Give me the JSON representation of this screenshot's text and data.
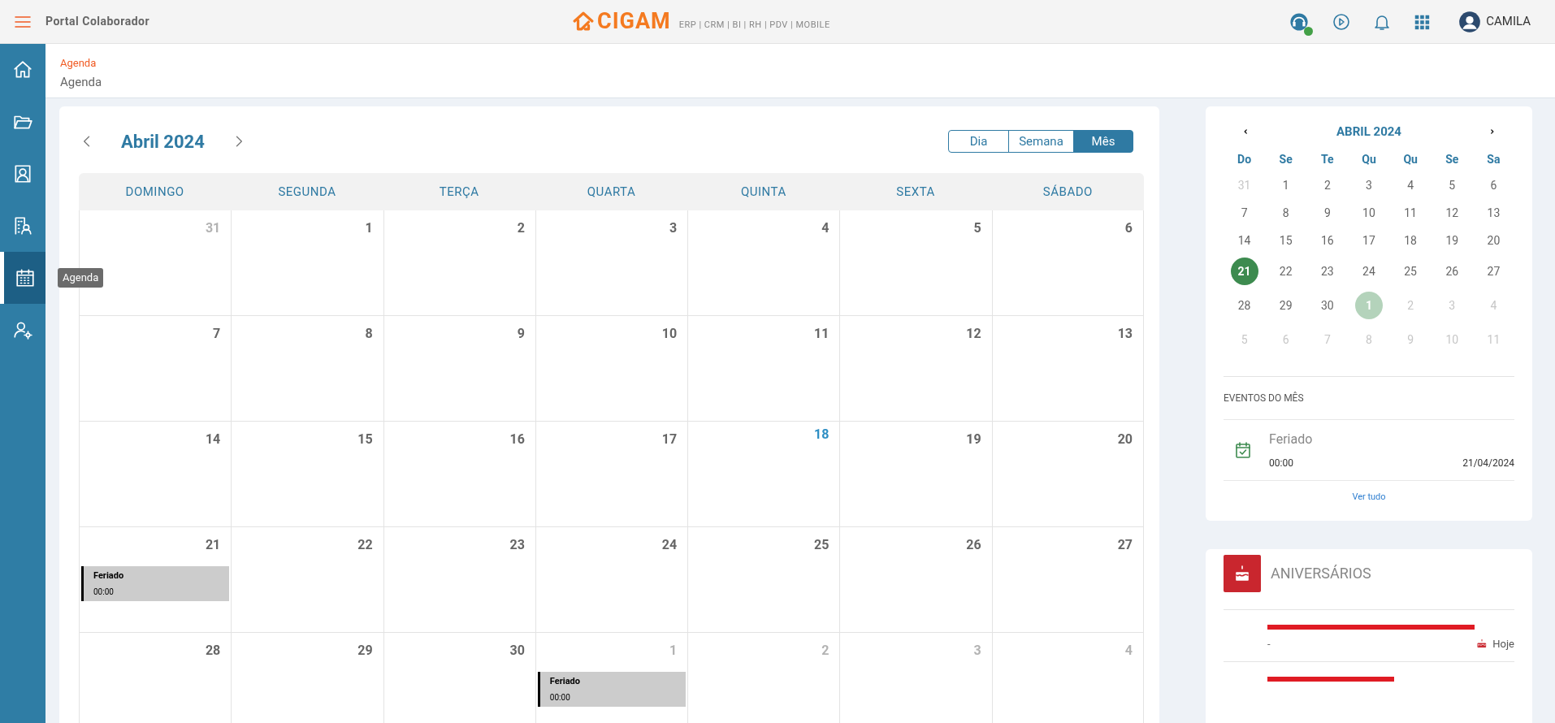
{
  "topbar": {
    "title": "Portal Colaborador",
    "brand": "CIGAM",
    "modules": "ERP | CRM | BI | RH | PDV | MOBILE",
    "support_online": true,
    "user": "CAMILA"
  },
  "sidebar": {
    "items": [
      {
        "kind": "home",
        "selected": false
      },
      {
        "kind": "folder",
        "selected": false
      },
      {
        "kind": "contact",
        "selected": false
      },
      {
        "kind": "building",
        "selected": false
      },
      {
        "kind": "calendar",
        "selected": true
      },
      {
        "kind": "user-settings",
        "selected": false
      }
    ],
    "tooltip": "Agenda"
  },
  "breadcrumb": {
    "link": "Agenda",
    "title": "Agenda"
  },
  "calendar": {
    "month": "Abril 2024",
    "views": [
      {
        "label": "Dia",
        "selected": false
      },
      {
        "label": "Semana",
        "selected": false
      },
      {
        "label": "Mês",
        "selected": true
      }
    ],
    "weekdays": [
      "DOMINGO",
      "SEGUNDA",
      "TERÇA",
      "QUARTA",
      "QUINTA",
      "SEXTA",
      "SÁBADO"
    ],
    "weeks": [
      [
        {
          "day": "31",
          "outside": true,
          "today": false
        },
        {
          "day": "1",
          "outside": false,
          "today": false
        },
        {
          "day": "2",
          "outside": false,
          "today": false
        },
        {
          "day": "3",
          "outside": false,
          "today": false
        },
        {
          "day": "4",
          "outside": false,
          "today": false
        },
        {
          "day": "5",
          "outside": false,
          "today": false
        },
        {
          "day": "6",
          "outside": false,
          "today": false
        }
      ],
      [
        {
          "day": "7",
          "outside": false,
          "today": false
        },
        {
          "day": "8",
          "outside": false,
          "today": false
        },
        {
          "day": "9",
          "outside": false,
          "today": false
        },
        {
          "day": "10",
          "outside": false,
          "today": false
        },
        {
          "day": "11",
          "outside": false,
          "today": false
        },
        {
          "day": "12",
          "outside": false,
          "today": false
        },
        {
          "day": "13",
          "outside": false,
          "today": false
        }
      ],
      [
        {
          "day": "14",
          "outside": false,
          "today": false
        },
        {
          "day": "15",
          "outside": false,
          "today": false
        },
        {
          "day": "16",
          "outside": false,
          "today": false
        },
        {
          "day": "17",
          "outside": false,
          "today": false
        },
        {
          "day": "18",
          "outside": false,
          "today": true
        },
        {
          "day": "19",
          "outside": false,
          "today": false
        },
        {
          "day": "20",
          "outside": false,
          "today": false
        }
      ],
      [
        {
          "day": "21",
          "outside": false,
          "today": false,
          "events": [
            {
              "title": "Feriado",
              "time": "00:00"
            }
          ]
        },
        {
          "day": "22",
          "outside": false,
          "today": false
        },
        {
          "day": "23",
          "outside": false,
          "today": false
        },
        {
          "day": "24",
          "outside": false,
          "today": false
        },
        {
          "day": "25",
          "outside": false,
          "today": false
        },
        {
          "day": "26",
          "outside": false,
          "today": false
        },
        {
          "day": "27",
          "outside": false,
          "today": false
        }
      ],
      [
        {
          "day": "28",
          "outside": false,
          "today": false
        },
        {
          "day": "29",
          "outside": false,
          "today": false
        },
        {
          "day": "30",
          "outside": false,
          "today": false
        },
        {
          "day": "1",
          "outside": true,
          "today": false,
          "events": [
            {
              "title": "Feriado",
              "time": "00:00"
            }
          ]
        },
        {
          "day": "2",
          "outside": true,
          "today": false
        },
        {
          "day": "3",
          "outside": true,
          "today": false
        },
        {
          "day": "4",
          "outside": true,
          "today": false
        }
      ]
    ]
  },
  "mini_calendar": {
    "month": "ABRIL 2024",
    "weekdays": [
      "Do",
      "Se",
      "Te",
      "Qu",
      "Qu",
      "Se",
      "Sa"
    ],
    "days": [
      {
        "day": "31",
        "outside": true,
        "kind": "plain"
      },
      {
        "day": "1",
        "outside": false,
        "kind": "plain"
      },
      {
        "day": "2",
        "outside": false,
        "kind": "plain"
      },
      {
        "day": "3",
        "outside": false,
        "kind": "plain"
      },
      {
        "day": "4",
        "outside": false,
        "kind": "plain"
      },
      {
        "day": "5",
        "outside": false,
        "kind": "plain"
      },
      {
        "day": "6",
        "outside": false,
        "kind": "plain"
      },
      {
        "day": "7",
        "outside": false,
        "kind": "plain"
      },
      {
        "day": "8",
        "outside": false,
        "kind": "plain"
      },
      {
        "day": "9",
        "outside": false,
        "kind": "plain"
      },
      {
        "day": "10",
        "outside": false,
        "kind": "plain"
      },
      {
        "day": "11",
        "outside": false,
        "kind": "plain"
      },
      {
        "day": "12",
        "outside": false,
        "kind": "plain"
      },
      {
        "day": "13",
        "outside": false,
        "kind": "plain"
      },
      {
        "day": "14",
        "outside": false,
        "kind": "plain"
      },
      {
        "day": "15",
        "outside": false,
        "kind": "plain"
      },
      {
        "day": "16",
        "outside": false,
        "kind": "plain"
      },
      {
        "day": "17",
        "outside": false,
        "kind": "plain"
      },
      {
        "day": "18",
        "outside": false,
        "kind": "plain"
      },
      {
        "day": "19",
        "outside": false,
        "kind": "plain"
      },
      {
        "day": "20",
        "outside": false,
        "kind": "plain"
      },
      {
        "day": "21",
        "outside": false,
        "kind": "selected"
      },
      {
        "day": "22",
        "outside": false,
        "kind": "plain"
      },
      {
        "day": "23",
        "outside": false,
        "kind": "plain"
      },
      {
        "day": "24",
        "outside": false,
        "kind": "plain"
      },
      {
        "day": "25",
        "outside": false,
        "kind": "plain"
      },
      {
        "day": "26",
        "outside": false,
        "kind": "plain"
      },
      {
        "day": "27",
        "outside": false,
        "kind": "plain"
      },
      {
        "day": "28",
        "outside": false,
        "kind": "plain"
      },
      {
        "day": "29",
        "outside": false,
        "kind": "plain"
      },
      {
        "day": "30",
        "outside": false,
        "kind": "plain"
      },
      {
        "day": "1",
        "outside": true,
        "kind": "event"
      },
      {
        "day": "2",
        "outside": true,
        "kind": "plain"
      },
      {
        "day": "3",
        "outside": true,
        "kind": "plain"
      },
      {
        "day": "4",
        "outside": true,
        "kind": "plain"
      },
      {
        "day": "5",
        "outside": true,
        "kind": "plain"
      },
      {
        "day": "6",
        "outside": true,
        "kind": "plain"
      },
      {
        "day": "7",
        "outside": true,
        "kind": "plain"
      },
      {
        "day": "8",
        "outside": true,
        "kind": "plain"
      },
      {
        "day": "9",
        "outside": true,
        "kind": "plain"
      },
      {
        "day": "10",
        "outside": true,
        "kind": "plain"
      },
      {
        "day": "11",
        "outside": true,
        "kind": "plain"
      }
    ]
  },
  "month_events": {
    "heading": "EVENTOS DO MÊS",
    "items": [
      {
        "title": "Feriado",
        "time": "00:00",
        "date": "21/04/2024"
      }
    ],
    "more": "Ver tudo"
  },
  "birthdays": {
    "heading": "ANIVERSÁRIOS",
    "items": [
      {
        "redacted": true,
        "detail": "-",
        "when": "Hoje"
      },
      {
        "redacted": true
      }
    ]
  }
}
